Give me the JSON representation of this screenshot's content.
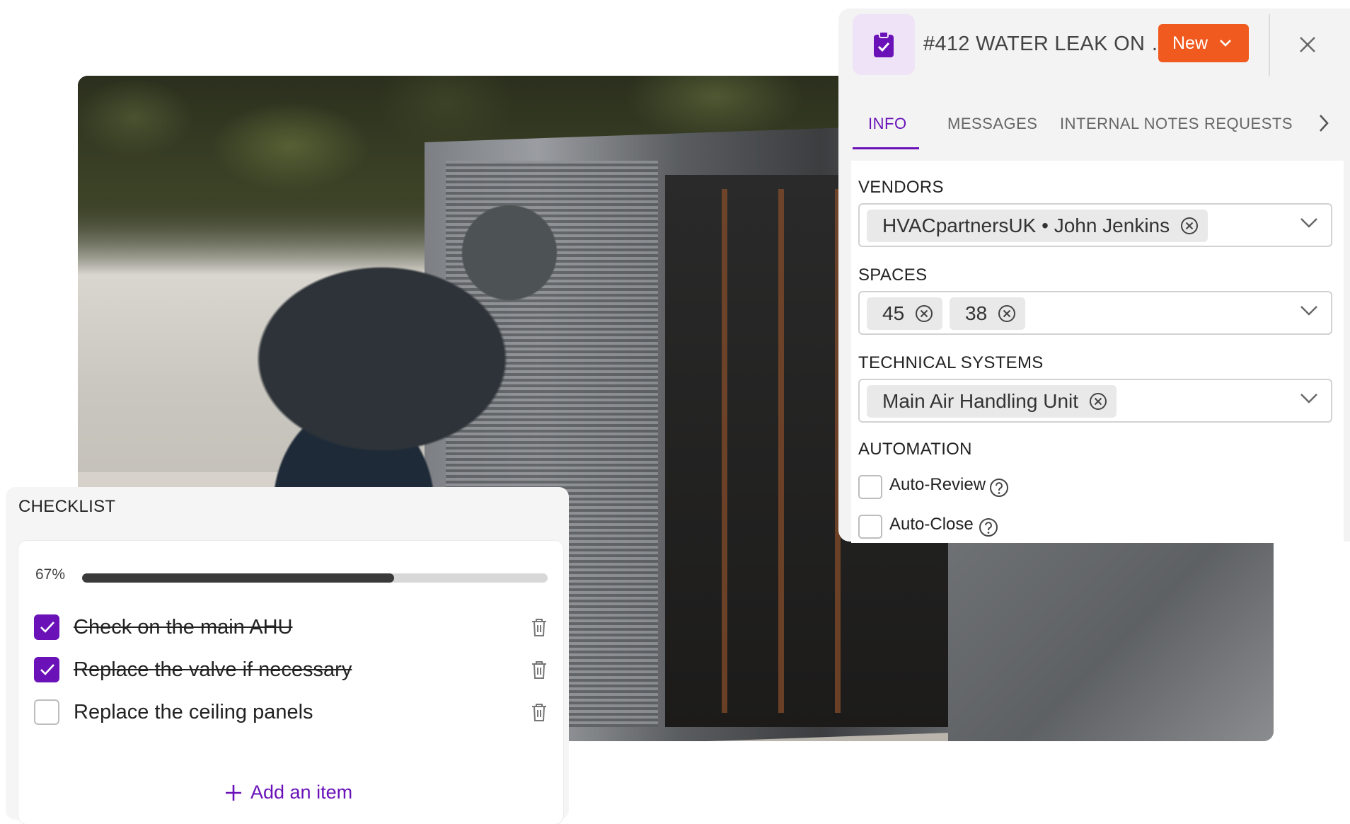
{
  "ticket": {
    "title": "#412 WATER LEAK ON …",
    "status": "New",
    "icon": "clipboard-check-icon",
    "accent": "#6a12b8",
    "status_color": "#f05a1e"
  },
  "tabs": [
    {
      "label": "INFO",
      "active": true
    },
    {
      "label": "MESSAGES",
      "active": false
    },
    {
      "label": "INTERNAL NOTES",
      "active": false
    },
    {
      "label": "REQUESTS",
      "active": false
    }
  ],
  "fields": {
    "vendors": {
      "label": "VENDORS",
      "chips": [
        "HVACpartnersUK • John Jenkins"
      ]
    },
    "spaces": {
      "label": "SPACES",
      "chips": [
        "45",
        "38"
      ]
    },
    "technical_systems": {
      "label": "TECHNICAL SYSTEMS",
      "chips": [
        "Main Air Handling Unit"
      ]
    }
  },
  "automation": {
    "label": "AUTOMATION",
    "options": [
      {
        "label": "Auto-Review",
        "checked": false
      },
      {
        "label": "Auto-Close",
        "checked": false
      }
    ]
  },
  "checklist": {
    "title": "CHECKLIST",
    "progress_label": "67%",
    "progress": 0.67,
    "items": [
      {
        "text": "Check on the main AHU",
        "checked": true
      },
      {
        "text": "Replace the valve if necessary",
        "checked": true
      },
      {
        "text": "Replace the ceiling panels",
        "checked": false
      }
    ],
    "add_label": "Add an item"
  }
}
